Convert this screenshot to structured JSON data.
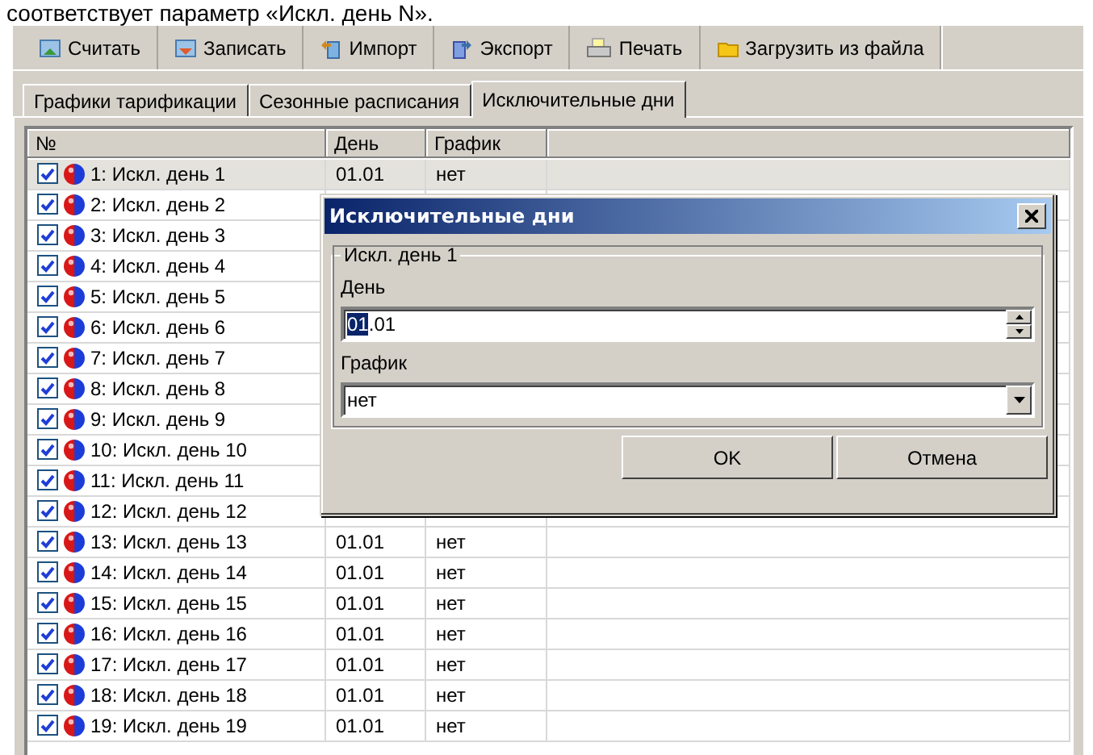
{
  "caption": "соответствует параметр «Искл. день N».",
  "toolbar": [
    {
      "label": "Считать",
      "kind": "read"
    },
    {
      "label": "Записать",
      "kind": "write"
    },
    {
      "label": "Импорт",
      "kind": "import"
    },
    {
      "label": "Экспорт",
      "kind": "export"
    },
    {
      "label": "Печать",
      "kind": "print"
    },
    {
      "label": "Загрузить из файла",
      "kind": "folder"
    }
  ],
  "tabs": [
    {
      "label": "Графики тарификации",
      "selected": false
    },
    {
      "label": "Сезонные расписания",
      "selected": false
    },
    {
      "label": "Исключительные дни",
      "selected": true
    }
  ],
  "table": {
    "columns": [
      "№",
      "День",
      "График"
    ],
    "rows": [
      {
        "name": "1: Искл. день 1",
        "checked": true,
        "selected": true,
        "day": "01.01",
        "schedule": "нет"
      },
      {
        "name": "2: Искл. день 2",
        "checked": true,
        "selected": false
      },
      {
        "name": "3: Искл. день 3",
        "checked": true,
        "selected": false
      },
      {
        "name": "4: Искл. день 4",
        "checked": true,
        "selected": false
      },
      {
        "name": "5: Искл. день 5",
        "checked": true,
        "selected": false
      },
      {
        "name": "6: Искл. день 6",
        "checked": true,
        "selected": false
      },
      {
        "name": "7: Искл. день 7",
        "checked": true,
        "selected": false
      },
      {
        "name": "8: Искл. день 8",
        "checked": true,
        "selected": false
      },
      {
        "name": "9: Искл. день 9",
        "checked": true,
        "selected": false
      },
      {
        "name": "10: Искл. день 10",
        "checked": true,
        "selected": false
      },
      {
        "name": "11: Искл. день 11",
        "checked": true,
        "selected": false
      },
      {
        "name": "12: Искл. день 12",
        "checked": true,
        "selected": false
      },
      {
        "name": "13: Искл. день 13",
        "checked": true,
        "selected": false,
        "day": "01.01",
        "schedule": "нет"
      },
      {
        "name": "14: Искл. день 14",
        "checked": true,
        "selected": false,
        "day": "01.01",
        "schedule": "нет"
      },
      {
        "name": "15: Искл. день 15",
        "checked": true,
        "selected": false,
        "day": "01.01",
        "schedule": "нет"
      },
      {
        "name": "16: Искл. день 16",
        "checked": true,
        "selected": false,
        "day": "01.01",
        "schedule": "нет"
      },
      {
        "name": "17: Искл. день 17",
        "checked": true,
        "selected": false,
        "day": "01.01",
        "schedule": "нет"
      },
      {
        "name": "18: Искл. день 18",
        "checked": true,
        "selected": false,
        "day": "01.01",
        "schedule": "нет"
      },
      {
        "name": "19: Искл. день 19",
        "checked": true,
        "selected": false,
        "day": "01.01",
        "schedule": "нет"
      }
    ]
  },
  "dialog": {
    "title": "Исключительные дни",
    "group": "Искл. день 1",
    "day_label": "День",
    "day_value_selected": "01",
    "day_value_rest": ".01",
    "schedule_label": "График",
    "schedule_value": "нет",
    "buttons": [
      "OK",
      "Отмена"
    ]
  }
}
